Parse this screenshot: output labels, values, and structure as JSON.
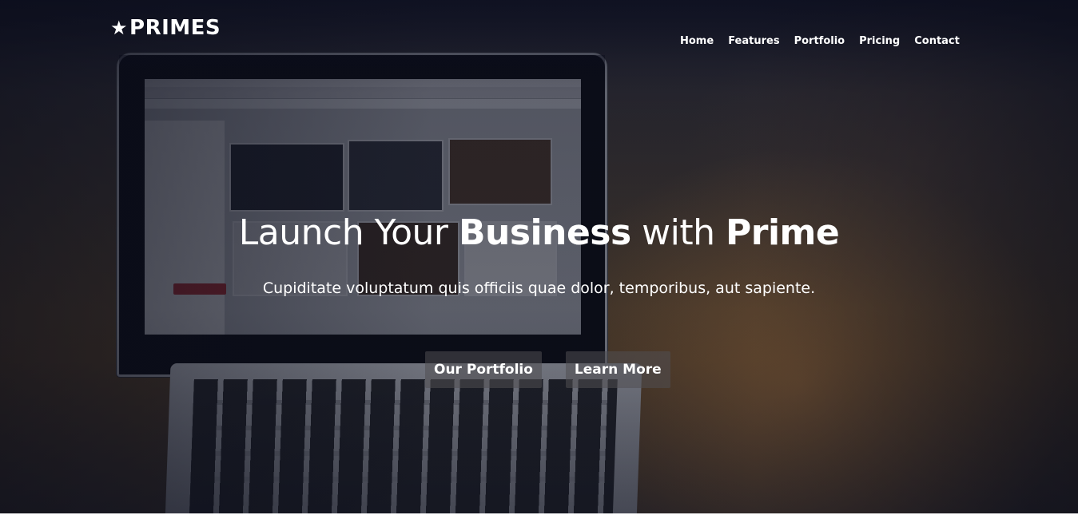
{
  "brand": {
    "icon": "star-icon",
    "name": "PRIMES"
  },
  "nav": {
    "items": [
      {
        "label": "Home"
      },
      {
        "label": "Features"
      },
      {
        "label": "Portfolio"
      },
      {
        "label": "Pricing"
      },
      {
        "label": "Contact"
      }
    ]
  },
  "hero": {
    "headline_part1": "Launch Your ",
    "headline_bold1": "Business",
    "headline_part2": " with ",
    "headline_bold2": "Prime",
    "subtitle": "Cupiditate voluptatum quis officiis quae dolor, temporibus, aut sapiente.",
    "primary_button": "Our Portfolio",
    "secondary_button": "Learn More"
  },
  "colors": {
    "text": "#ffffff",
    "button_bg": "#504e52"
  }
}
